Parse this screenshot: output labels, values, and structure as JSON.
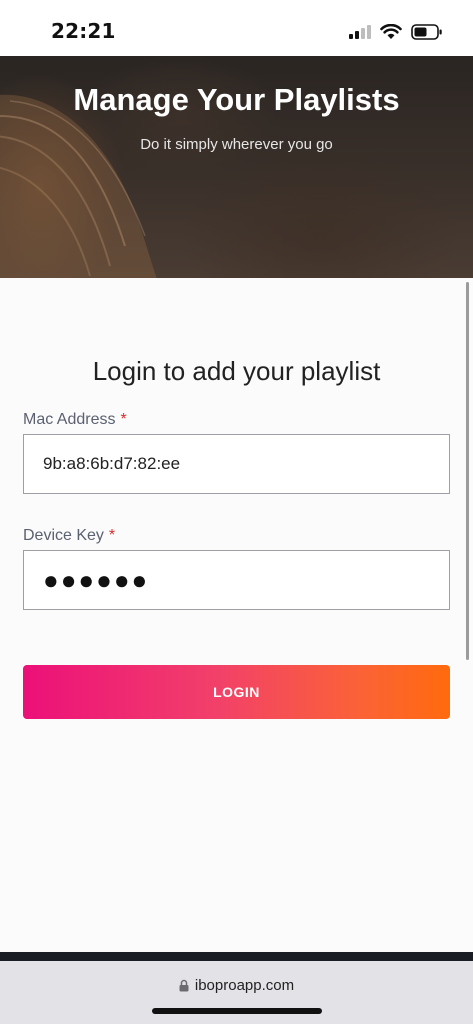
{
  "status_bar": {
    "time": "22:21"
  },
  "hero": {
    "title": "Manage Your Playlists",
    "subtitle": "Do it simply wherever you go"
  },
  "form": {
    "title": "Login to add your playlist",
    "mac_address": {
      "label": "Mac Address",
      "required_mark": "*",
      "value": "9b:a8:6b:d7:82:ee"
    },
    "device_key": {
      "label": "Device Key",
      "required_mark": "*",
      "masked_value": "●●●●●●"
    },
    "login_label": "LOGIN"
  },
  "browser": {
    "url": "iboproapp.com"
  },
  "colors": {
    "button_gradient_start": "#ec1079",
    "button_gradient_end": "#ff6a0d",
    "required_mark": "#d32f2f"
  }
}
